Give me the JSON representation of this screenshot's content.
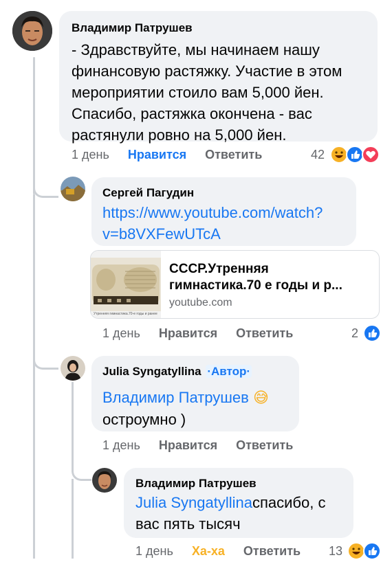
{
  "comment1": {
    "author": "Владимир Патрушев",
    "text_lines": [
      "- Здравствуйте, мы начинаем нашу",
      "финансовую растяжку. Участие в этом",
      "мероприятии стоило вам 5,000 йен.",
      "Спасибо, растяжка окончена - вас",
      "растянули ровно на 5,000 йен."
    ],
    "time": "1 день",
    "like": "Нравится",
    "reply": "Ответить",
    "reaction_count": "42",
    "reactions": [
      "haha-icon",
      "like-icon",
      "love-icon"
    ]
  },
  "comment2": {
    "author": "Сергей Пагудин",
    "link_lines": [
      "https://www.youtube.com/watch?",
      "v=b8VXFewUTcA"
    ],
    "preview": {
      "title_lines": [
        "СССР.Утренняя",
        "гимнастика.70 е годы и р..."
      ],
      "domain": "youtube.com",
      "thumb_caption": "Утренняя гимнастика.70-е годы и ранее"
    },
    "time": "1 день",
    "like": "Нравится",
    "reply": "Ответить",
    "reaction_count": "2",
    "reactions": [
      "like-icon"
    ]
  },
  "comment3": {
    "author": "Julia Syngatyllina",
    "author_badge": "·Автор·",
    "mention": "Владимир Патрушев",
    "emoji": "😅",
    "text": "остроумно )",
    "time": "1 день",
    "like": "Нравится",
    "reply": "Ответить"
  },
  "comment4": {
    "author": "Владимир Патрушев",
    "mention": "Julia Syngatyllina",
    "text_after_mention": "спасибо, с",
    "text_line2": "вас пять тысяч",
    "time": "1 день",
    "like": "Ха-ха",
    "reply": "Ответить",
    "reaction_count": "13",
    "reactions": [
      "haha-icon",
      "like-icon"
    ]
  },
  "colors": {
    "link": "#1877f2",
    "bubble": "#f0f2f5",
    "meta": "#65676b",
    "haha": "#f7b125",
    "love": "#f33e58"
  }
}
